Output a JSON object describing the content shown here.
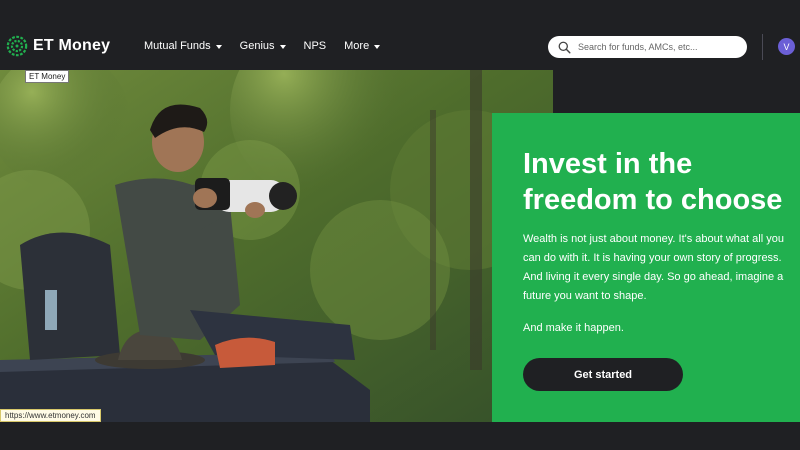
{
  "brand": {
    "name": "ET Money",
    "tooltip": "ET Money",
    "accent": "#21b04f"
  },
  "nav": {
    "items": [
      {
        "label": "Mutual Funds",
        "has_dropdown": true
      },
      {
        "label": "Genius",
        "has_dropdown": true
      },
      {
        "label": "NPS",
        "has_dropdown": false
      },
      {
        "label": "More",
        "has_dropdown": true
      }
    ]
  },
  "search": {
    "placeholder": "Search for funds, AMCs, etc...",
    "icon": "search-icon"
  },
  "user": {
    "initial": "V"
  },
  "hero": {
    "title_line1": "Invest in the",
    "title_line2": "freedom to choose",
    "body_lines": [
      "Wealth is not just about money. It's about what all you",
      "can do with it. It is having your own story of progress.",
      "And living it every single day. So go ahead, imagine a",
      "future you want to shape."
    ],
    "tagline": "And make it happen.",
    "cta": "Get started"
  },
  "status": {
    "url": "https://www.etmoney.com"
  }
}
